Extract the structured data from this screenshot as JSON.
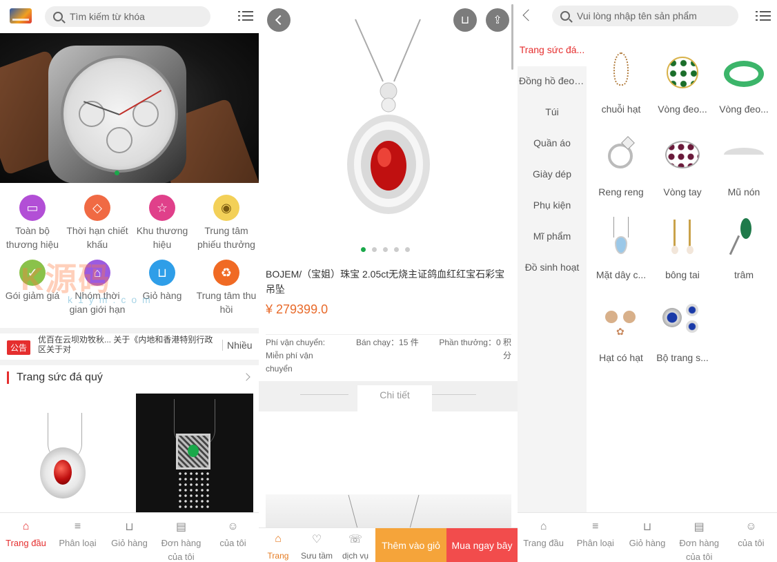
{
  "p1": {
    "search_placeholder": "Tìm kiếm từ khóa",
    "icons": [
      {
        "label": "Toàn bộ thương hiệu",
        "color": "#b24fd6",
        "glyph": "▭"
      },
      {
        "label": "Thời hạn chiết khấu",
        "color": "#f06a44",
        "glyph": "◇"
      },
      {
        "label": "Khu thương hiệu",
        "color": "#e0408a",
        "glyph": "☆"
      },
      {
        "label": "Trung tâm phiếu thưởng",
        "color": "#f3d058",
        "glyph": "◉"
      },
      {
        "label": "Gói giảm giá",
        "color": "#8ac24a",
        "glyph": "✓"
      },
      {
        "label": "Nhóm thời gian giới hạn",
        "color": "#9b5be0",
        "glyph": "⌂"
      },
      {
        "label": "Giỏ hàng",
        "color": "#2f9ee8",
        "glyph": "⊔"
      },
      {
        "label": "Trung tâm thu hồi",
        "color": "#f06a24",
        "glyph": "♻"
      }
    ],
    "notice_badge": "公告",
    "notice_text": "优百在云坝劝牧秋... 关于《内地和香港特别行政区关于对",
    "notice_more": "Nhiều",
    "section_title": "Trang sức đá quý",
    "tabs": [
      {
        "label": "Trang đầu",
        "icon": "⌂",
        "icon_name": "home-icon"
      },
      {
        "label": "Phân loại",
        "icon": "≡",
        "icon_name": "list-icon"
      },
      {
        "label": "Giỏ hàng",
        "icon": "⊔",
        "icon_name": "cart-icon"
      },
      {
        "label": "Đơn hàng của tôi",
        "icon": "▤",
        "icon_name": "order-icon"
      },
      {
        "label": "của tôi",
        "icon": "☺",
        "icon_name": "user-icon"
      }
    ],
    "watermark": "K源码",
    "watermark_sub": "k1ym.com"
  },
  "p2": {
    "title": "BOJEM/（宝姐）珠宝 2.05ct无烧主证鸽血红红宝石彩宝吊坠",
    "price": "¥ 279399.0",
    "shipping_label": "Phí vận chuyển:",
    "shipping_value": "Miễn phí vận chuyển",
    "sold": "Bán chạy：15 件",
    "points": "Phần thưởng：0 积分",
    "detail_label": "Chi tiết",
    "tabs": [
      {
        "label": "Trang",
        "icon": "⌂"
      },
      {
        "label": "Sưu tầm",
        "icon": "♡"
      },
      {
        "label": "dịch vụ",
        "icon": "☏"
      }
    ],
    "add_cart": "Thêm vào giỏ",
    "buy_now": "Mua ngay bây"
  },
  "p3": {
    "search_placeholder": "Vui lòng nhập tên sản phẩm",
    "categories": [
      "Trang sức đá...",
      "Đồng hồ đeo t...",
      "Túi",
      "Quần áo",
      "Giày dép",
      "Phụ kiện",
      "Mĩ phẩm",
      "Đồ sinh hoạt"
    ],
    "products": [
      "chuỗi hạt",
      "Vòng đeo...",
      "Vòng đeo...",
      "Reng reng",
      "Vòng tay",
      "Mũ nón",
      "Mặt dây c...",
      "bông tai",
      "trâm",
      "Hạt có hạt",
      "Bộ trang s..."
    ],
    "tabs": [
      "Trang đầu",
      "Phân loại",
      "Giỏ hàng",
      "Đơn hàng của tôi",
      "của tôi"
    ]
  },
  "colors": {
    "accent": "#e52e2e",
    "price": "#e86a2a",
    "add_cart": "#f5a43a",
    "buy": "#f24c4c"
  }
}
